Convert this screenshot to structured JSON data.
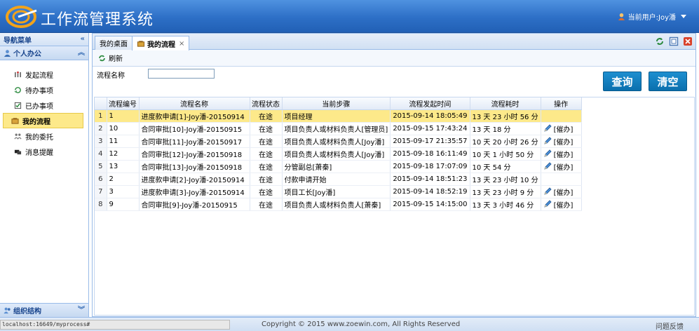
{
  "app": {
    "title": "工作流管理系统",
    "user_label": "当前用户:Joy潘"
  },
  "sidebar": {
    "header": "导航菜单",
    "group": "个人办公",
    "items": [
      {
        "label": "发起流程",
        "icon": "flow-start-icon"
      },
      {
        "label": "待办事项",
        "icon": "todo-icon"
      },
      {
        "label": "已办事项",
        "icon": "done-icon"
      },
      {
        "label": "我的流程",
        "icon": "my-process-icon",
        "active": true
      },
      {
        "label": "我的委托",
        "icon": "delegate-icon"
      },
      {
        "label": "消息提醒",
        "icon": "message-icon"
      }
    ],
    "bottom_group": "组织结构"
  },
  "tabs": [
    {
      "label": "我的桌面"
    },
    {
      "label": "我的流程",
      "active": true,
      "close": "×"
    }
  ],
  "toolbar": {
    "refresh_label": "刷新"
  },
  "filter": {
    "label": "流程名称",
    "value": ""
  },
  "buttons": {
    "query": "查询",
    "clear": "清空"
  },
  "grid": {
    "columns": [
      "",
      "流程编号",
      "流程名称",
      "流程状态",
      "当前步骤",
      "流程发起时间",
      "流程耗时",
      "操作"
    ],
    "rows": [
      {
        "rn": "1",
        "id": "1",
        "name": "进度款申请[1]-Joy潘-20150914",
        "status": "在途",
        "step": "项目经理",
        "time": "2015-09-14 18:05:49",
        "duration": "13 天 23 小时 56 分",
        "op": "",
        "highlight": true
      },
      {
        "rn": "2",
        "id": "10",
        "name": "合同审批[10]-Joy潘-20150915",
        "status": "在途",
        "step": "项目负责人或材料负责人[管理员]",
        "time": "2015-09-15 17:43:24",
        "duration": "13 天 18 分",
        "op": "[催办]"
      },
      {
        "rn": "3",
        "id": "11",
        "name": "合同审批[11]-Joy潘-20150917",
        "status": "在途",
        "step": "项目负责人或材料负责人[Joy潘]",
        "time": "2015-09-17 21:35:57",
        "duration": "10 天 20 小时 26 分",
        "op": "[催办]"
      },
      {
        "rn": "4",
        "id": "12",
        "name": "合同审批[12]-Joy潘-20150918",
        "status": "在途",
        "step": "项目负责人或材料负责人[Joy潘]",
        "time": "2015-09-18 16:11:49",
        "duration": "10 天 1 小时 50 分",
        "op": "[催办]"
      },
      {
        "rn": "5",
        "id": "13",
        "name": "合同审批[13]-Joy潘-20150918",
        "status": "在途",
        "step": "分管副总[萧秦]",
        "time": "2015-09-18 17:07:09",
        "duration": "10 天 54 分",
        "op": "[催办]"
      },
      {
        "rn": "6",
        "id": "2",
        "name": "进度款申请[2]-Joy潘-20150914",
        "status": "在途",
        "step": "付款申请开始",
        "time": "2015-09-14 18:51:23",
        "duration": "13 天 23 小时 10 分",
        "op": ""
      },
      {
        "rn": "7",
        "id": "3",
        "name": "进度款申请[3]-Joy潘-20150914",
        "status": "在途",
        "step": "项目工长[Joy潘]",
        "time": "2015-09-14 18:52:19",
        "duration": "13 天 23 小时 9 分",
        "op": "[催办]"
      },
      {
        "rn": "8",
        "id": "9",
        "name": "合同审批[9]-Joy潘-20150915",
        "status": "在途",
        "step": "项目负责人或材料负责人[萧秦]",
        "time": "2015-09-15 14:15:00",
        "duration": "13 天 3 小时 46 分",
        "op": "[催办]"
      }
    ]
  },
  "footer": {
    "url": "localhost:16649/myprocess#",
    "copyright": "Copyright © 2015 www.zoewin.com, All Rights Reserved",
    "feedback": "问题反馈"
  },
  "colors": {
    "header": "#2d6fc6",
    "highlight": "#fde98a",
    "button": "#0a6fad"
  }
}
